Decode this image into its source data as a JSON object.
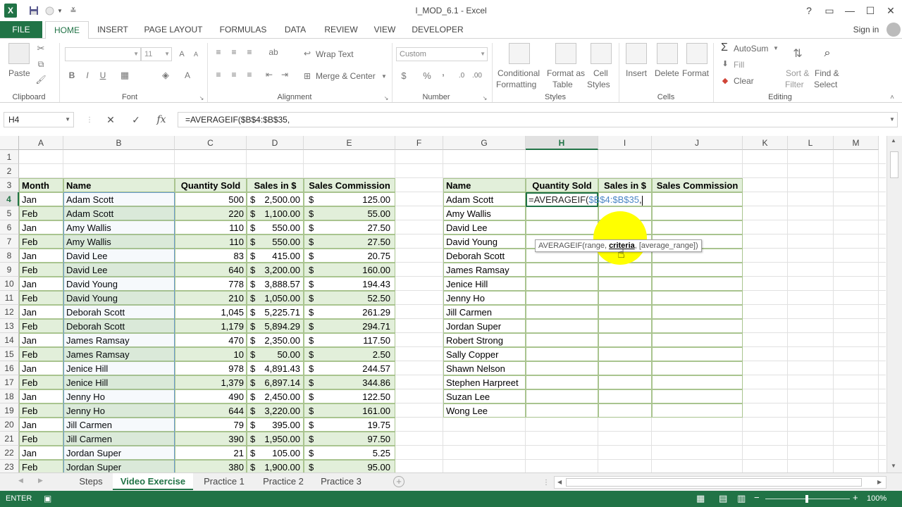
{
  "app": {
    "title": "I_MOD_6.1 - Excel",
    "sign_in": "Sign in"
  },
  "window_controls": {
    "help": "?",
    "restore_ribbon": "▭",
    "minimize": "—",
    "maximize": "☐",
    "close": "✕"
  },
  "qat": {
    "excel_logo": "X",
    "customize": "≚"
  },
  "tabs": [
    "FILE",
    "HOME",
    "INSERT",
    "PAGE LAYOUT",
    "FORMULAS",
    "DATA",
    "REVIEW",
    "VIEW",
    "DEVELOPER"
  ],
  "ribbon": {
    "clipboard": {
      "label": "Clipboard",
      "paste": "Paste"
    },
    "font": {
      "label": "Font",
      "size": "11",
      "bold": "B",
      "italic": "I",
      "underline": "U",
      "font_color": "A"
    },
    "alignment": {
      "label": "Alignment",
      "wrap": "Wrap Text",
      "merge": "Merge & Center"
    },
    "number": {
      "label": "Number",
      "format": "Custom",
      "currency": "$",
      "percent": "%",
      "comma": ","
    },
    "styles": {
      "label": "Styles",
      "cond1": "Conditional",
      "cond2": "Formatting",
      "fmt1": "Format as",
      "fmt2": "Table",
      "cs1": "Cell",
      "cs2": "Styles"
    },
    "cells": {
      "label": "Cells",
      "insert": "Insert",
      "delete": "Delete",
      "format": "Format"
    },
    "editing": {
      "label": "Editing",
      "autosum": "AutoSum",
      "fill": "Fill",
      "clear": "Clear",
      "sort1": "Sort &",
      "sort2": "Filter",
      "find1": "Find &",
      "find2": "Select"
    }
  },
  "formula_bar": {
    "name_box": "H4",
    "cancel": "✕",
    "enter": "✓",
    "fx": "fx",
    "formula": "=AVERAGEIF($B$4:$B$35,"
  },
  "columns": [
    "A",
    "B",
    "C",
    "D",
    "E",
    "F",
    "G",
    "H",
    "I",
    "J",
    "K",
    "L",
    "M"
  ],
  "rows": [
    "1",
    "2",
    "3",
    "4",
    "5",
    "6",
    "7",
    "8",
    "9",
    "10",
    "11",
    "12",
    "13",
    "14",
    "15",
    "16",
    "17",
    "18",
    "19",
    "20",
    "21",
    "22",
    "23"
  ],
  "table1": {
    "headers": [
      "Month",
      "Name",
      "Quantity Sold",
      "Sales in $",
      "Sales Commission"
    ],
    "currency_symbol": "$",
    "rows": [
      [
        "Jan",
        "Adam Scott",
        "500",
        "2,500.00",
        "125.00"
      ],
      [
        "Feb",
        "Adam Scott",
        "220",
        "1,100.00",
        "55.00"
      ],
      [
        "Jan",
        "Amy Wallis",
        "110",
        "550.00",
        "27.50"
      ],
      [
        "Feb",
        "Amy Wallis",
        "110",
        "550.00",
        "27.50"
      ],
      [
        "Jan",
        "David Lee",
        "83",
        "415.00",
        "20.75"
      ],
      [
        "Feb",
        "David Lee",
        "640",
        "3,200.00",
        "160.00"
      ],
      [
        "Jan",
        "David Young",
        "778",
        "3,888.57",
        "194.43"
      ],
      [
        "Feb",
        "David Young",
        "210",
        "1,050.00",
        "52.50"
      ],
      [
        "Jan",
        "Deborah Scott",
        "1,045",
        "5,225.71",
        "261.29"
      ],
      [
        "Feb",
        "Deborah Scott",
        "1,179",
        "5,894.29",
        "294.71"
      ],
      [
        "Jan",
        "James Ramsay",
        "470",
        "2,350.00",
        "117.50"
      ],
      [
        "Feb",
        "James Ramsay",
        "10",
        "50.00",
        "2.50"
      ],
      [
        "Jan",
        "Jenice Hill",
        "978",
        "4,891.43",
        "244.57"
      ],
      [
        "Feb",
        "Jenice Hill",
        "1,379",
        "6,897.14",
        "344.86"
      ],
      [
        "Jan",
        "Jenny Ho",
        "490",
        "2,450.00",
        "122.50"
      ],
      [
        "Feb",
        "Jenny Ho",
        "644",
        "3,220.00",
        "161.00"
      ],
      [
        "Jan",
        "Jill Carmen",
        "79",
        "395.00",
        "19.75"
      ],
      [
        "Feb",
        "Jill Carmen",
        "390",
        "1,950.00",
        "97.50"
      ],
      [
        "Jan",
        "Jordan Super",
        "21",
        "105.00",
        "5.25"
      ],
      [
        "Feb",
        "Jordan Super",
        "380",
        "1,900.00",
        "95.00"
      ]
    ]
  },
  "table2": {
    "headers": [
      "Name",
      "Quantity Sold",
      "Sales in $",
      "Sales Commission"
    ],
    "names": [
      "Adam Scott",
      "Amy Wallis",
      "David Lee",
      "David Young",
      "Deborah Scott",
      "James Ramsay",
      "Jenice Hill",
      "Jenny Ho",
      "Jill Carmen",
      "Jordan Super",
      "Robert Strong",
      "Sally Copper",
      "Shawn Nelson",
      "Stephen Harpreet",
      "Suzan Lee",
      "Wong Lee"
    ],
    "edit_prefix": "=AVERAGEIF(",
    "edit_range": "$B$4:$B$35",
    "edit_suffix": ","
  },
  "tooltip": {
    "fn": "AVERAGEIF(range, ",
    "arg": "criteria",
    "rest": ", [average_range])"
  },
  "sheet_tabs": [
    "Steps",
    "Video Exercise",
    "Practice 1",
    "Practice 2",
    "Practice 3"
  ],
  "status": {
    "mode": "ENTER",
    "zoom": "100%"
  },
  "colors": {
    "excel_green": "#217346",
    "header_fill": "#e2efda",
    "range_highlight": "#6b9bd2",
    "cursor_highlight": "#ffff00"
  }
}
